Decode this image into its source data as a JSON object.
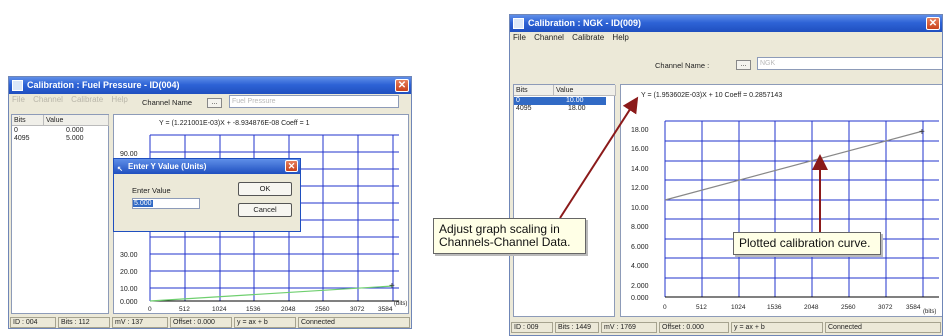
{
  "left_window": {
    "title": "Calibration : Fuel Pressure - ID(004)",
    "menu": [
      "File",
      "Channel",
      "Calibrate",
      "Help"
    ],
    "channel_name_label": "Channel Name",
    "channel_btn": "...",
    "channel_name_value": "Fuel Pressure",
    "table": {
      "headers": [
        "Bits",
        "Value"
      ],
      "rows": [
        [
          "0",
          "0.000"
        ],
        [
          "4095",
          "5.000"
        ]
      ]
    },
    "equation": "Y = (1.221001E-03)X + -8.934876E-08     Coeff = 1",
    "y_ticks_top": [
      "90.00"
    ],
    "y_ticks_bottom": [
      "30.00",
      "20.00",
      "10.00",
      "0.000"
    ],
    "x_ticks": [
      "0",
      "512",
      "1024",
      "1536",
      "2048",
      "2560",
      "3072",
      "3584",
      "(bits)"
    ],
    "status": [
      "ID : 004",
      "Bits : 112",
      "mV : 137",
      "Offset : 0.000",
      "y = ax + b",
      "Connected"
    ]
  },
  "dialog": {
    "title": "Enter Y Value (Units)",
    "enter_value_label": "Enter Value",
    "value": "5.000",
    "ok": "OK",
    "cancel": "Cancel"
  },
  "right_window": {
    "title": "Calibration : NGK - ID(009)",
    "menu": [
      "File",
      "Channel",
      "Calibrate",
      "Help"
    ],
    "channel_name_label": "Channel Name :",
    "channel_btn": "...",
    "channel_name_value": "NGK",
    "table": {
      "headers": [
        "Bits",
        "Value"
      ],
      "rows": [
        [
          "0",
          "10.00"
        ],
        [
          "4095",
          "18.00"
        ]
      ]
    },
    "equation": "Y = (1.953602E-03)X + 10     Coeff = 0.2857143",
    "y_ticks": [
      "18.00",
      "16.00",
      "14.00",
      "12.00",
      "10.00",
      "8.000",
      "6.000",
      "4.000",
      "2.000",
      "0.000"
    ],
    "x_ticks": [
      "0",
      "512",
      "1024",
      "1536",
      "2048",
      "2560",
      "3072",
      "3584",
      "(bits)"
    ],
    "status": [
      "ID : 009",
      "Bits : 1449",
      "mV : 1769",
      "Offset : 0.000",
      "y = ax + b",
      "Connected"
    ]
  },
  "callouts": {
    "scaling": "Adjust graph scaling in Channels-Channel Data.",
    "curve": "Plotted calibration curve."
  },
  "colors": {
    "grid": "#2233cc",
    "curve_left": "#6fcf6f",
    "curve_right": "#888888",
    "arrow": "#8b1a1a",
    "titlebar": "#2e63d6"
  }
}
